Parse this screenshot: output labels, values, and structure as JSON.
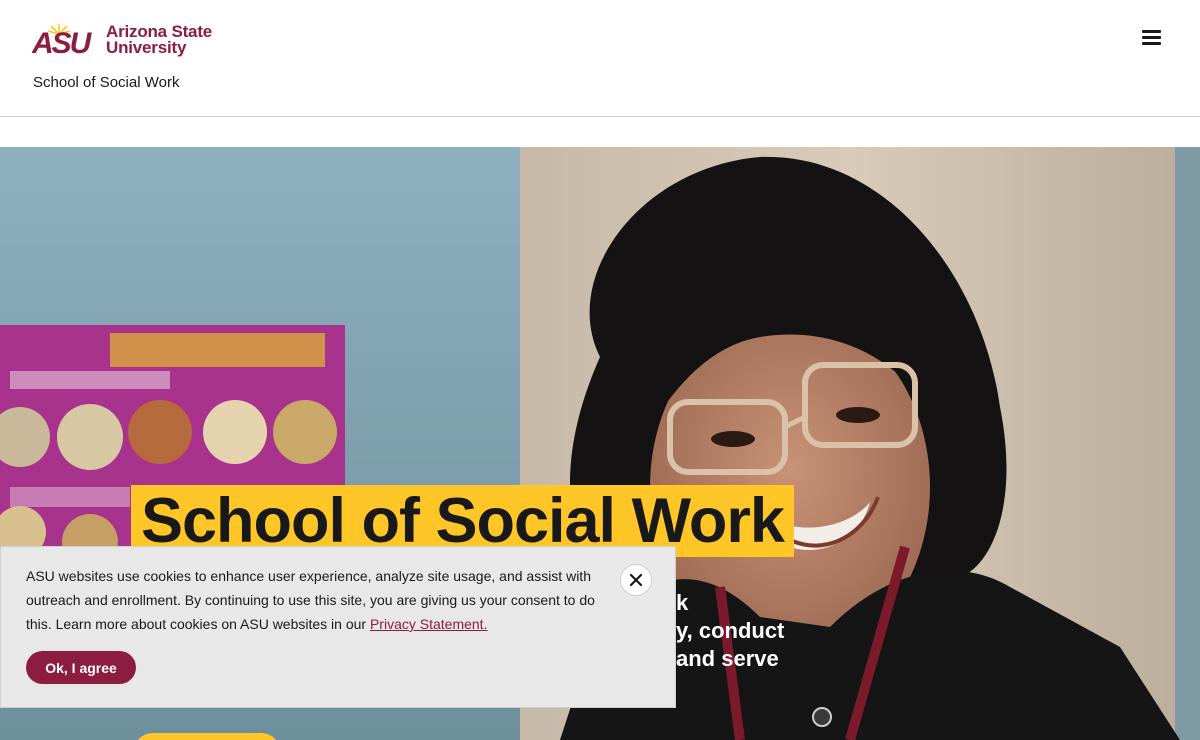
{
  "header": {
    "logo_line1": "Arizona State",
    "logo_line2": "University",
    "logo_mark_text": "ASU",
    "site_name": "School of Social Work",
    "menu_icon": "hamburger-menu-icon"
  },
  "hero": {
    "title": "School of Social Work",
    "line1": "k",
    "line2": "y, conduct",
    "line3": "and serve"
  },
  "cookie": {
    "text": "ASU websites use cookies to enhance user experience, analyze site usage, and assist with outreach and enrollment. By continuing to use this site, you are giving us your consent to do this. Learn more about cookies on ASU websites in our ",
    "link": "Privacy Statement.",
    "button": "Ok, I agree",
    "close_icon": "close-icon"
  },
  "colors": {
    "maroon": "#8c1d40",
    "gold": "#ffc627",
    "banner_bg": "#e8e8e8"
  }
}
